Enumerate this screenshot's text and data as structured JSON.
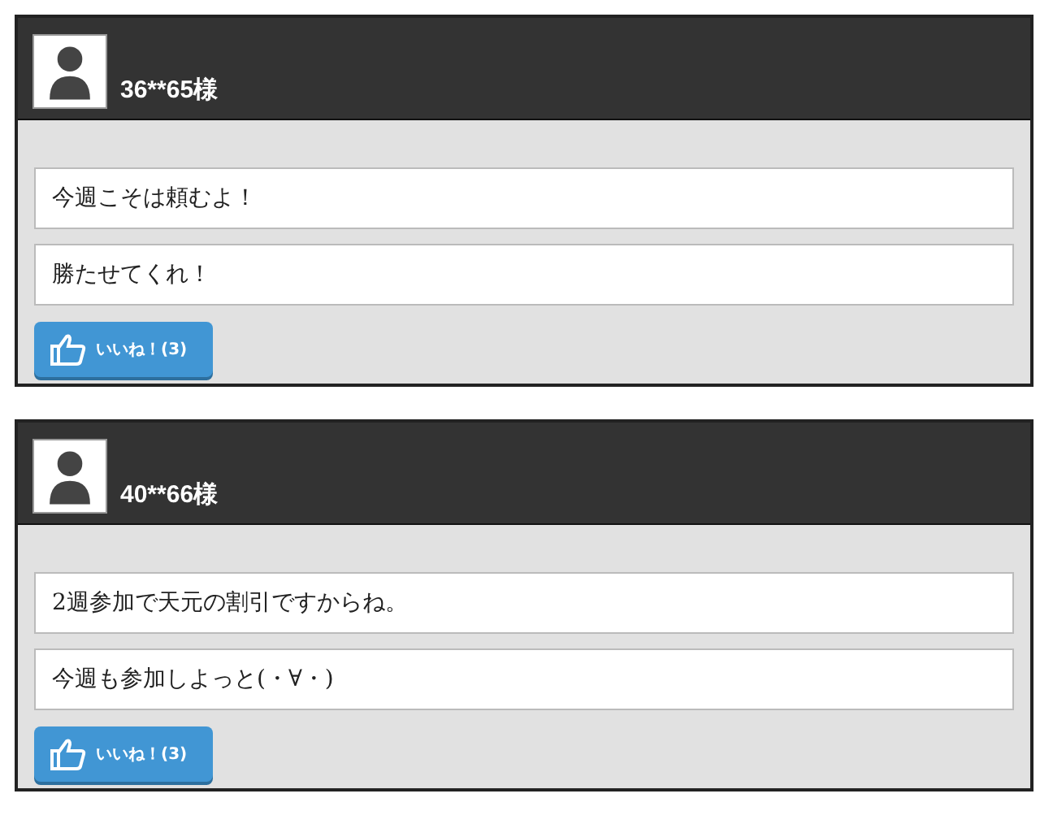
{
  "posts": [
    {
      "user": "36**65様",
      "comments": [
        "今週こそは頼むよ！",
        "勝たせてくれ！"
      ],
      "like_button": "いいね！(3)"
    },
    {
      "user": "40**66様",
      "comments": [
        "2週参加で天元の割引ですからね。",
        "今週も参加しよっと(・∀・)"
      ],
      "like_button": "いいね！(3)"
    }
  ]
}
